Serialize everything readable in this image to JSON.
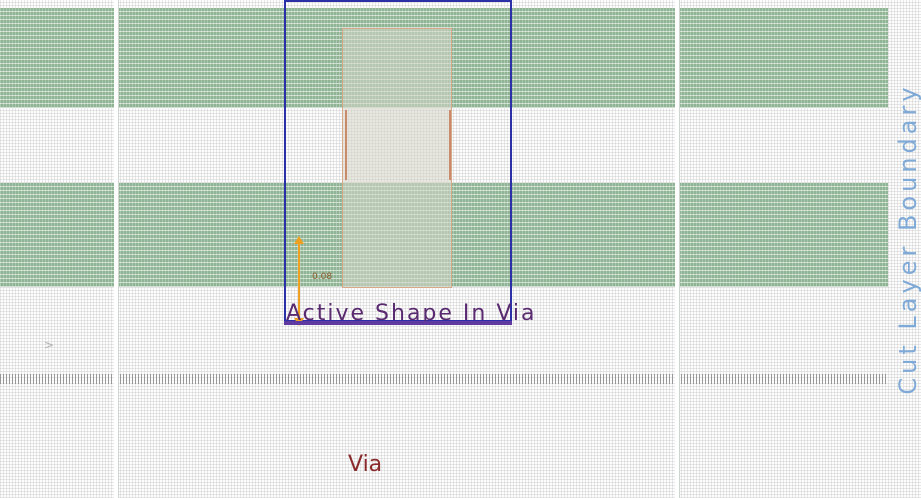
{
  "layout_view": {
    "labels": {
      "active_shape": "Active Shape In Via",
      "via": "Via",
      "dimension": "0.08",
      "side_caption": "Cut Layer Boundary",
      "marker": ">"
    },
    "colors": {
      "metal_band": "#8fb494",
      "via_outline": "#2b2fa8",
      "dimension_arrow": "#f0a020",
      "active_label": "#5a2a70",
      "via_label": "#8a2a2a"
    }
  }
}
